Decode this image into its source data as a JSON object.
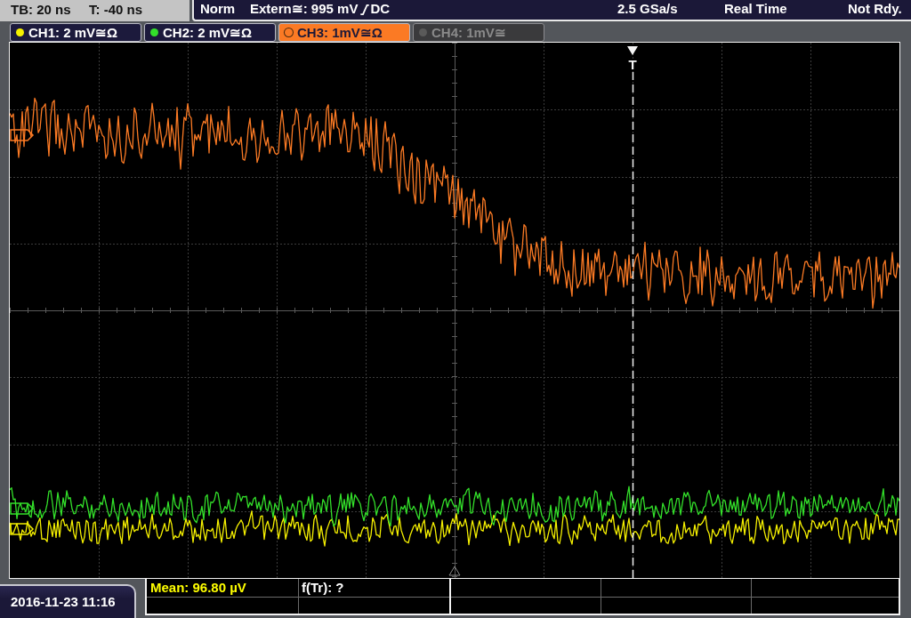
{
  "status_bar": {
    "timebase": "TB: 20 ns",
    "trigger_offset": "T: -40 ns"
  },
  "trigger_bar": {
    "mode": "Norm",
    "source_level": "Extern≅: 995 mV",
    "slope_rising": true,
    "coupling": "DC",
    "sample_rate": "2.5 GSa/s",
    "acquisition": "Real Time",
    "state": "Not Rdy."
  },
  "channels": [
    {
      "label": "CH1: 2 mV≅Ω",
      "color": "#f5f000",
      "selected": false,
      "disabled": false
    },
    {
      "label": "CH2: 2 mV≅Ω",
      "color": "#33e02a",
      "selected": false,
      "disabled": false
    },
    {
      "label": "CH3: 1mV≅Ω",
      "color": "#fb7a24",
      "selected": true,
      "disabled": false
    },
    {
      "label": "CH4: 1mV≅",
      "color": "#5a5a5a",
      "selected": false,
      "disabled": true
    }
  ],
  "trigger_marker": {
    "label": "T"
  },
  "timestamp": "2016-11-23 11:16",
  "measurements": [
    {
      "text": "Mean: 96.80 µV",
      "color": "#ffff00"
    },
    {
      "text": "f(Tr): ?",
      "color": "#ffffff"
    }
  ]
}
